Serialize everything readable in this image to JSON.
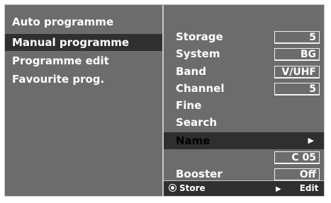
{
  "menu": {
    "items": [
      {
        "label": "Auto programme",
        "active": false
      },
      {
        "label": "Manual programme",
        "active": true
      },
      {
        "label": "Programme edit",
        "active": false
      },
      {
        "label": "Favourite prog.",
        "active": false
      }
    ]
  },
  "settings": {
    "storage": {
      "label": "Storage",
      "value": "5"
    },
    "system": {
      "label": "System",
      "value": "BG"
    },
    "band": {
      "label": "Band",
      "value": "V/UHF"
    },
    "channel": {
      "label": "Channel",
      "value": "5"
    },
    "fine": {
      "label": "Fine"
    },
    "search": {
      "label": "Search"
    },
    "name": {
      "label": "Name",
      "value": "C 05"
    },
    "booster": {
      "label": "Booster",
      "value": "Off"
    }
  },
  "footer": {
    "store_label": "Store",
    "edit_label": "Edit"
  },
  "colors": {
    "panel": "#6c6c6c",
    "highlight": "#2f2f2f",
    "border": "#c8c8c8"
  }
}
